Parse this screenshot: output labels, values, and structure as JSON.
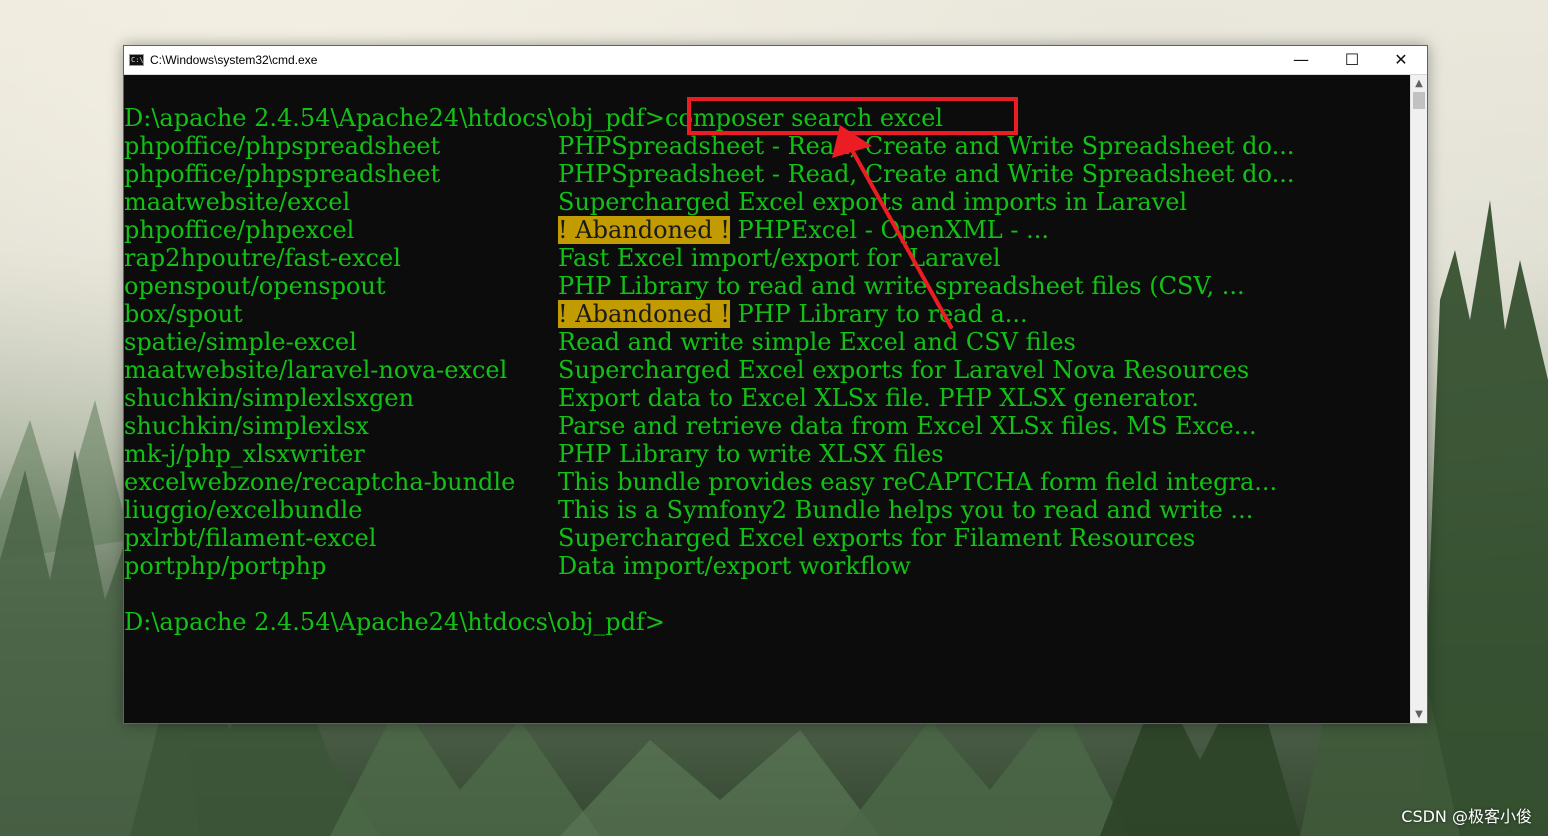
{
  "window": {
    "title": "C:\\Windows\\system32\\cmd.exe",
    "icon": "cmd-icon",
    "controls": {
      "minimize": "—",
      "maximize": "☐",
      "close": "✕"
    }
  },
  "terminal": {
    "prompt": "D:\\apache 2.4.54\\Apache24\\htdocs\\obj_pdf>",
    "command": "composer search excel",
    "results": [
      {
        "package": "phpoffice/phpspreadsheet",
        "abandoned": "",
        "description": "PHPSpreadsheet - Read, Create and Write Spreadsheet do..."
      },
      {
        "package": "phpoffice/phpspreadsheet",
        "abandoned": "",
        "description": "PHPSpreadsheet - Read, Create and Write Spreadsheet do..."
      },
      {
        "package": "maatwebsite/excel",
        "abandoned": "",
        "description": "Supercharged Excel exports and imports in Laravel"
      },
      {
        "package": "phpoffice/phpexcel",
        "abandoned": "! Abandoned !",
        "description": " PHPExcel - OpenXML - ..."
      },
      {
        "package": "rap2hpoutre/fast-excel",
        "abandoned": "",
        "description": "Fast Excel import/export for Laravel"
      },
      {
        "package": "openspout/openspout",
        "abandoned": "",
        "description": "PHP Library to read and write spreadsheet files (CSV, ..."
      },
      {
        "package": "box/spout",
        "abandoned": "! Abandoned !",
        "description": " PHP Library to read a..."
      },
      {
        "package": "spatie/simple-excel",
        "abandoned": "",
        "description": "Read and write simple Excel and CSV files"
      },
      {
        "package": "maatwebsite/laravel-nova-excel",
        "abandoned": "",
        "description": "Supercharged Excel exports for Laravel Nova Resources"
      },
      {
        "package": "shuchkin/simplexlsxgen",
        "abandoned": "",
        "description": "Export data to Excel XLSx file. PHP XLSX generator."
      },
      {
        "package": "shuchkin/simplexlsx",
        "abandoned": "",
        "description": "Parse and retrieve data from Excel XLSx files. MS Exce..."
      },
      {
        "package": "mk-j/php_xlsxwriter",
        "abandoned": "",
        "description": "PHP Library to write XLSX files"
      },
      {
        "package": "excelwebzone/recaptcha-bundle",
        "abandoned": "",
        "description": "This bundle provides easy reCAPTCHA form field integra..."
      },
      {
        "package": "liuggio/excelbundle",
        "abandoned": "",
        "description": "This is a Symfony2 Bundle helps you to read and write ..."
      },
      {
        "package": "pxlrbt/filament-excel",
        "abandoned": "",
        "description": "Supercharged Excel exports for Filament Resources"
      },
      {
        "package": "portphp/portphp",
        "abandoned": "",
        "description": "Data import/export workflow"
      }
    ],
    "final_prompt": "D:\\apache 2.4.54\\Apache24\\htdocs\\obj_pdf>"
  },
  "colors": {
    "terminal_text": "#13c116",
    "terminal_bg": "#0c0c0c",
    "abandoned_bg": "#c29b00",
    "annotation": "#ec1c24",
    "window_border": "#1a73c7"
  },
  "watermark": "CSDN @极客小俊"
}
